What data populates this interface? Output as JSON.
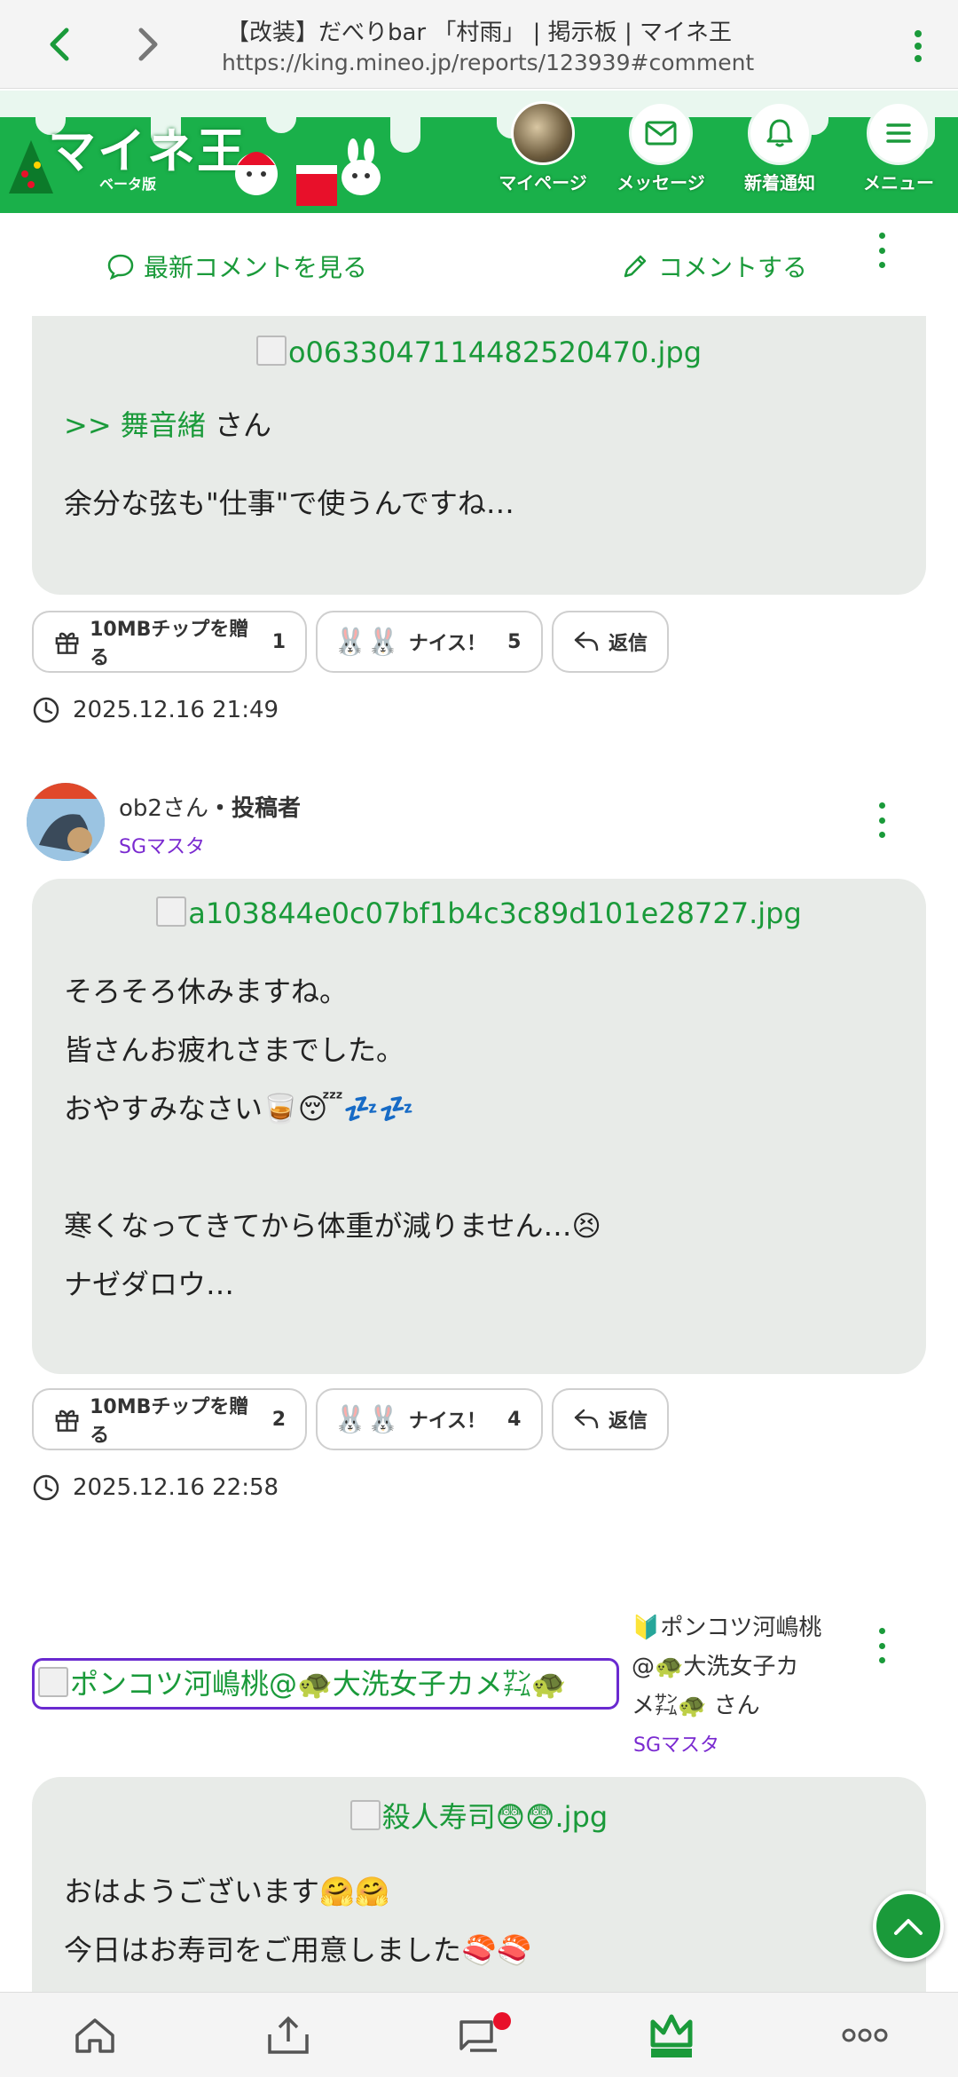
{
  "browser": {
    "title": "【改装】だべりbar 「村雨」 | 掲示板 | マイネ王",
    "url": "https://king.mineo.jp/reports/123939#comment..."
  },
  "header": {
    "logo": "マイネ王",
    "beta": "ベータ版",
    "items": [
      {
        "label": "マイページ"
      },
      {
        "label": "メッセージ"
      },
      {
        "label": "新着通知"
      },
      {
        "label": "メニュー"
      }
    ]
  },
  "actions": {
    "latest": "最新コメントを見る",
    "comment": "コメントする"
  },
  "comments": [
    {
      "image": "o0633047114482520470.jpg",
      "reply_prefix": ">> ",
      "reply_name": "舞音緒",
      "reply_suffix": " さん",
      "lines": [
        "余分な弦も\"仕事\"で使うんですね…"
      ],
      "gift": "10MBチップを贈る",
      "gift_count": "1",
      "nice": "ナイス！",
      "nice_count": "5",
      "reply": "返信",
      "timestamp": "2025.12.16 21:49"
    },
    {
      "user": "ob2さん",
      "role": "・投稿者",
      "badge": "SGマスタ",
      "image": "a103844e0c07bf1b4c3c89d101e28727.jpg",
      "lines": [
        "そろそろ休みますね。",
        "皆さんお疲れさまでした。",
        "おやすみなさい🥃😴💤💤",
        "",
        "寒くなってきてから体重が減りません…😣",
        "ナゼダロウ…"
      ],
      "gift": "10MBチップを贈る",
      "gift_count": "2",
      "nice": "ナイス！",
      "nice_count": "4",
      "reply": "返信",
      "timestamp": "2025.12.16 22:58"
    },
    {
      "broken_avatar": "ポンコツ河嶋桃@🐢大洗女子カメ㌠🐢",
      "user_line1": "🔰ポンコツ河嶋桃",
      "user_line2": "@🐢大洗女子カ",
      "user_line3": "メ㌠🐢 さん",
      "badge": "SGマスタ",
      "image": "殺人寿司😨😨.jpg",
      "lines": [
        "おはようございます🤗🤗",
        "今日はお寿司をご用意しました🍣🍣"
      ]
    }
  ],
  "colors": {
    "brand": "#1a9a3a",
    "header_bg": "#1ab04a",
    "badge": "#7a2ad0"
  }
}
